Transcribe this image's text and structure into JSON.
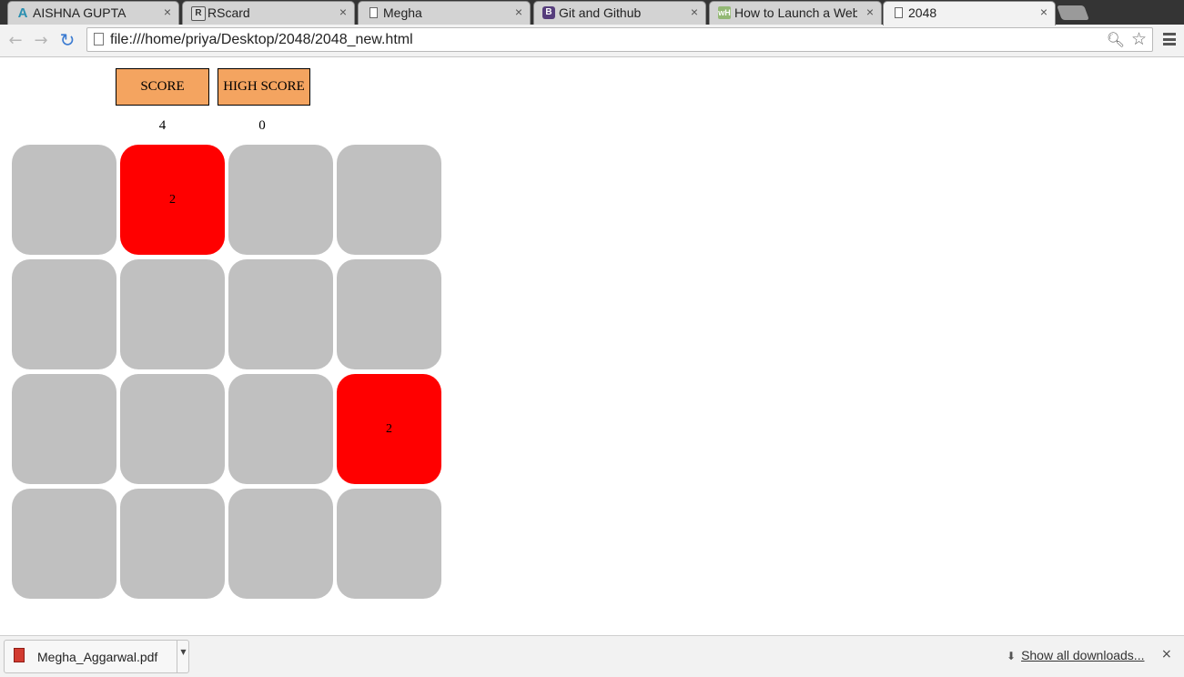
{
  "browser": {
    "tabs": [
      {
        "title": "AISHNA GUPTA",
        "icon": "aishna-favicon-icon",
        "active": false
      },
      {
        "title": "RScard",
        "icon": "rscard-favicon-icon",
        "active": false
      },
      {
        "title": "Megha",
        "icon": "page-icon",
        "active": false
      },
      {
        "title": "Git and Github",
        "icon": "bootstrap-favicon-icon",
        "active": false
      },
      {
        "title": "How to Launch a Web",
        "icon": "wikihow-favicon-icon",
        "active": false
      },
      {
        "title": "2048",
        "icon": "page-icon",
        "active": true
      }
    ],
    "tab_close_glyph": "×",
    "address": "file:///home/priya/Desktop/2048/2048_new.html"
  },
  "game": {
    "score_label": "SCORE",
    "high_score_label": "HIGH SCORE",
    "score": "4",
    "high_score": "0",
    "tile_color": "#ff0000",
    "empty_color": "#c0c0c0",
    "button_color": "#f4a460",
    "board": [
      [
        "",
        "2",
        "",
        ""
      ],
      [
        "",
        "",
        "",
        ""
      ],
      [
        "",
        "",
        "",
        "2"
      ],
      [
        "",
        "",
        "",
        ""
      ]
    ]
  },
  "downloads": {
    "file_name": "Megha_Aggarwal.pdf",
    "show_all": "Show all downloads...",
    "close_glyph": "×"
  }
}
